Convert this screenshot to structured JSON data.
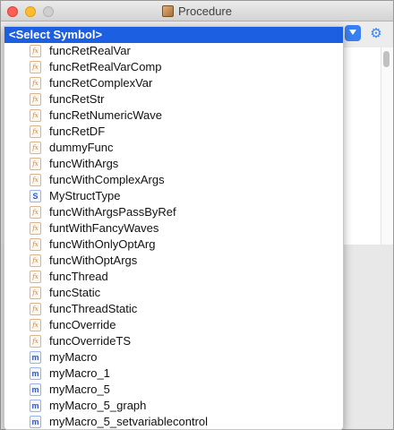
{
  "window": {
    "title": "Procedure",
    "title_icon": "package-icon"
  },
  "menu": {
    "header": "<Select Symbol>",
    "items": [
      {
        "label": "funcRetRealVar",
        "icon": "fx"
      },
      {
        "label": "funcRetRealVarComp",
        "icon": "fx"
      },
      {
        "label": "funcRetComplexVar",
        "icon": "fx"
      },
      {
        "label": "funcRetStr",
        "icon": "fx"
      },
      {
        "label": "funcRetNumericWave",
        "icon": "fx"
      },
      {
        "label": "funcRetDF",
        "icon": "fx"
      },
      {
        "label": "dummyFunc",
        "icon": "fx"
      },
      {
        "label": "funcWithArgs",
        "icon": "fx"
      },
      {
        "label": "funcWithComplexArgs",
        "icon": "fx"
      },
      {
        "label": "MyStructType",
        "icon": "S"
      },
      {
        "label": "funcWithArgsPassByRef",
        "icon": "fx"
      },
      {
        "label": "funtWithFancyWaves",
        "icon": "fx"
      },
      {
        "label": "funcWithOnlyOptArg",
        "icon": "fx"
      },
      {
        "label": "funcWithOptArgs",
        "icon": "fx"
      },
      {
        "label": "funcThread",
        "icon": "fx"
      },
      {
        "label": "funcStatic",
        "icon": "fx"
      },
      {
        "label": "funcThreadStatic",
        "icon": "fx"
      },
      {
        "label": "funcOverride",
        "icon": "fx"
      },
      {
        "label": "funcOverrideTS",
        "icon": "fx"
      },
      {
        "label": "myMacro",
        "icon": "m"
      },
      {
        "label": "myMacro_1",
        "icon": "m"
      },
      {
        "label": "myMacro_5",
        "icon": "m"
      },
      {
        "label": "myMacro_5_graph",
        "icon": "m"
      },
      {
        "label": "myMacro_5_setvariablecontrol",
        "icon": "m"
      }
    ]
  },
  "colors": {
    "selection": "#1c5fe0",
    "accent": "#3a7ff0",
    "function_icon": "#d77d2b",
    "macro_icon": "#2759c9"
  }
}
